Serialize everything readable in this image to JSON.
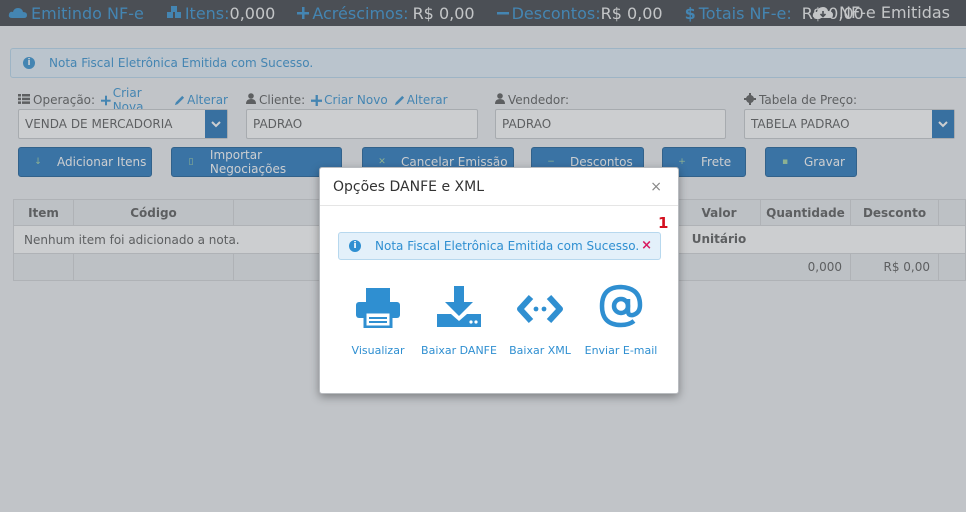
{
  "topbar": {
    "title": "Emitindo NF-e",
    "itens_label": "Itens:",
    "itens_value": "0,000",
    "acrescimos_label": "Acréscimos:",
    "acrescimos_value": "R$ 0,00",
    "descontos_label": "Descontos:",
    "descontos_value": "R$ 0,00",
    "totais_label": "Totais NF-e:",
    "totais_value": "R$ 0,00",
    "emitidas_label": "NF-e Emitidas"
  },
  "page_alert": "Nota Fiscal Eletrônica Emitida com Sucesso.",
  "form": {
    "operacao_label": "Operação:",
    "operacao_criar": "Criar Nova",
    "operacao_alterar": "Alterar",
    "operacao_value": "VENDA DE MERCADORIA",
    "cliente_label": "Cliente:",
    "cliente_criar": "Criar Novo",
    "cliente_alterar": "Alterar",
    "cliente_value": "PADRAO",
    "vendedor_label": "Vendedor:",
    "vendedor_value": "PADRAO",
    "tabela_label": "Tabela de Preço:",
    "tabela_value": "TABELA PADRAO"
  },
  "buttons": {
    "adicionar": "Adicionar Itens",
    "importar": "Importar Negociações",
    "cancelar": "Cancelar Emissão",
    "descontos": "Descontos",
    "frete": "Frete",
    "gravar": "Gravar"
  },
  "table": {
    "headers": [
      "Item",
      "Código",
      "Valor Unitário",
      "Quantidade",
      "Desconto"
    ],
    "empty_message": "Nenhum item foi adicionado a nota.",
    "footer_quantidade": "0,000",
    "footer_desconto": "R$ 0,00"
  },
  "modal": {
    "title": "Opções DANFE e XML",
    "close": "×",
    "badge": "1",
    "alert": "Nota Fiscal Eletrônica Emitida com Sucesso.",
    "alert_close": "×",
    "actions": [
      {
        "label": "Visualizar",
        "icon": "print-icon"
      },
      {
        "label": "Baixar DANFE",
        "icon": "download-icon"
      },
      {
        "label": "Baixar XML",
        "icon": "code-icon"
      },
      {
        "label": "Enviar E-mail",
        "icon": "at-icon"
      }
    ]
  },
  "colors": {
    "accent": "#2f8fd1",
    "button": "#1f73bc",
    "topbar": "#3a3d42"
  }
}
